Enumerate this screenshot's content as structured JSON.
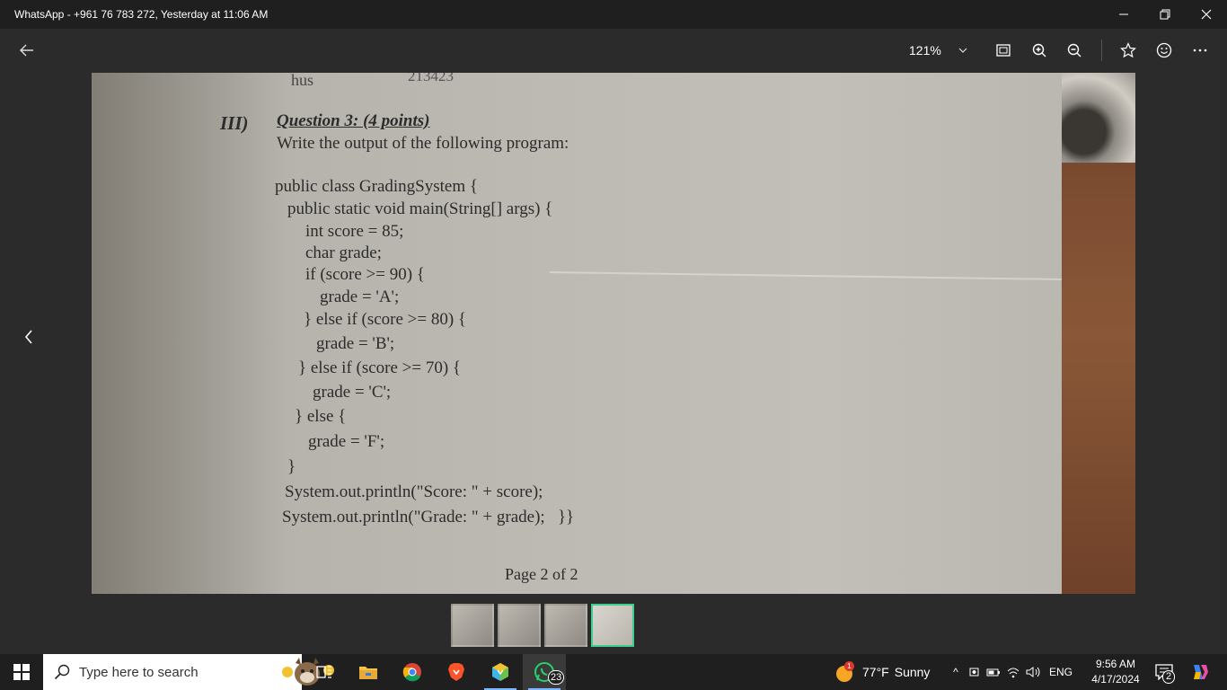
{
  "window": {
    "title": "WhatsApp - +961 76 783 272, Yesterday at 11:06 AM"
  },
  "toolbar": {
    "zoom": "121%",
    "icons": [
      "back-arrow-icon",
      "fit-screen-icon",
      "zoom-in-icon",
      "zoom-out-icon",
      "star-icon",
      "emoji-icon",
      "more-icon"
    ]
  },
  "document": {
    "header_left": "hus",
    "header_right": "213423",
    "section_number": "III)",
    "question_title": "Question 3: (4 points)",
    "instruction": "Write the output of the following program:",
    "code_lines": [
      "public class GradingSystem {",
      "public static void main(String[] args) {",
      "int score = 85;",
      "char grade;",
      "if (score >= 90) {",
      "grade = 'A';",
      "} else if (score >= 80) {",
      "grade = 'B';",
      "} else if (score >= 70) {",
      "grade = 'C';",
      "} else {",
      "grade = 'F';",
      "}",
      "System.out.println(\"Score: \" + score);",
      "System.out.println(\"Grade: \" + grade);   }}"
    ],
    "footer": "Page 2 of 2"
  },
  "taskbar": {
    "search_placeholder": "Type here to search",
    "whatsapp_badge": "23",
    "weather_temp": "77°F",
    "weather_desc": "Sunny",
    "weather_alert": "1",
    "language": "ENG",
    "time": "9:56 AM",
    "date": "4/17/2024",
    "notifications": "2"
  }
}
